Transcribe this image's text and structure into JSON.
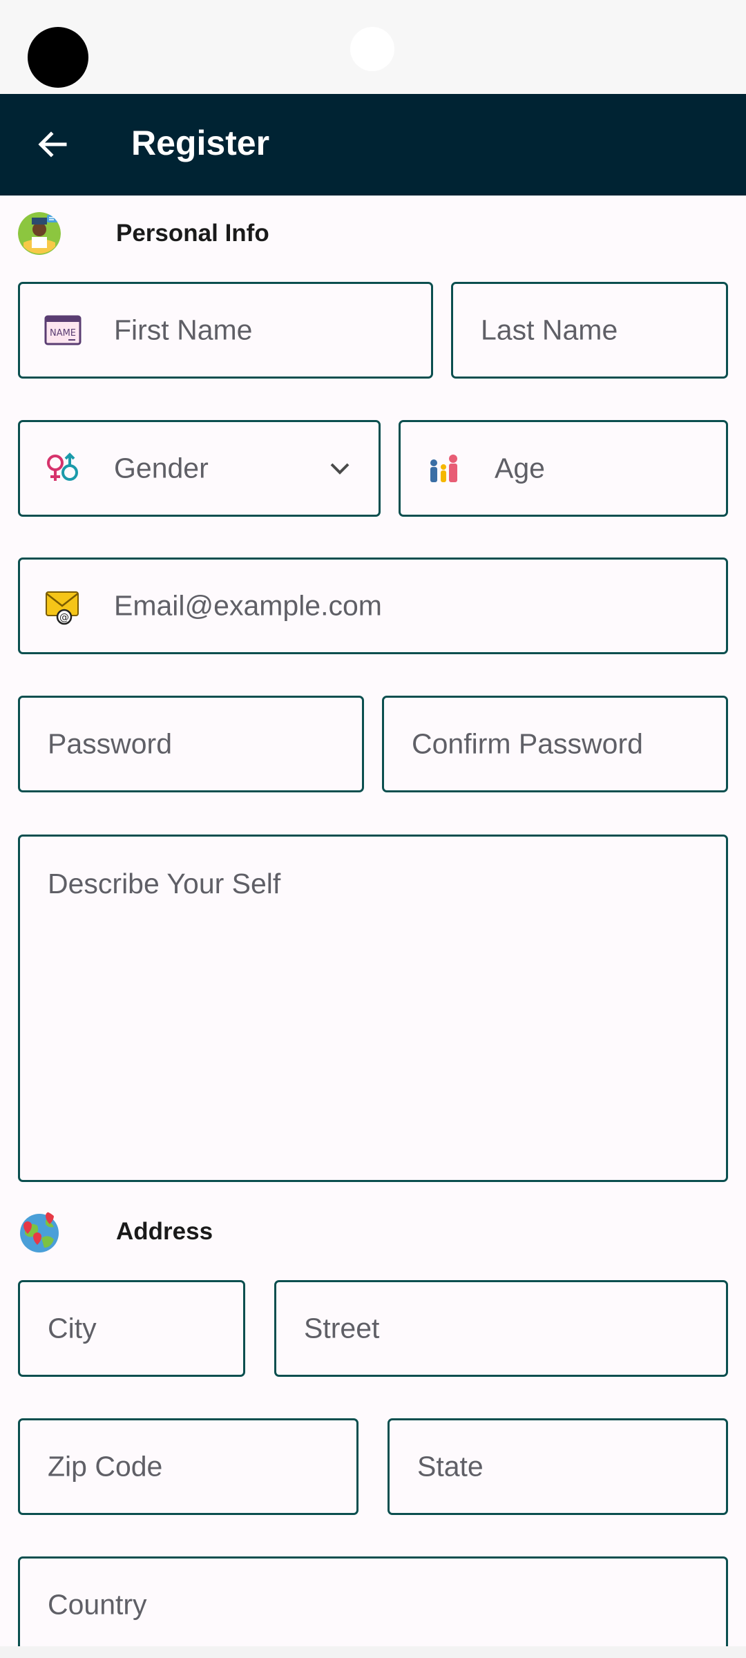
{
  "app_bar": {
    "title": "Register"
  },
  "sections": {
    "personal": {
      "title": "Personal Info"
    },
    "address": {
      "title": "Address"
    }
  },
  "fields": {
    "first_name": "First Name",
    "last_name": "Last Name",
    "gender": "Gender",
    "age": "Age",
    "email": "Email@example.com",
    "password": "Password",
    "confirm_password": "Confirm Password",
    "describe": "Describe Your Self",
    "city": "City",
    "street": "Street",
    "zip": "Zip Code",
    "state": "State",
    "country": "Country"
  },
  "icons": {
    "name": "name-tag-icon",
    "gender": "gender-symbols-icon",
    "age": "family-icon",
    "email": "envelope-at-icon",
    "personal": "person-avatar-icon",
    "address": "globe-pins-icon"
  },
  "colors": {
    "app_bar": "#002333",
    "field_border": "#0b4f4f",
    "background": "#fefafd"
  }
}
